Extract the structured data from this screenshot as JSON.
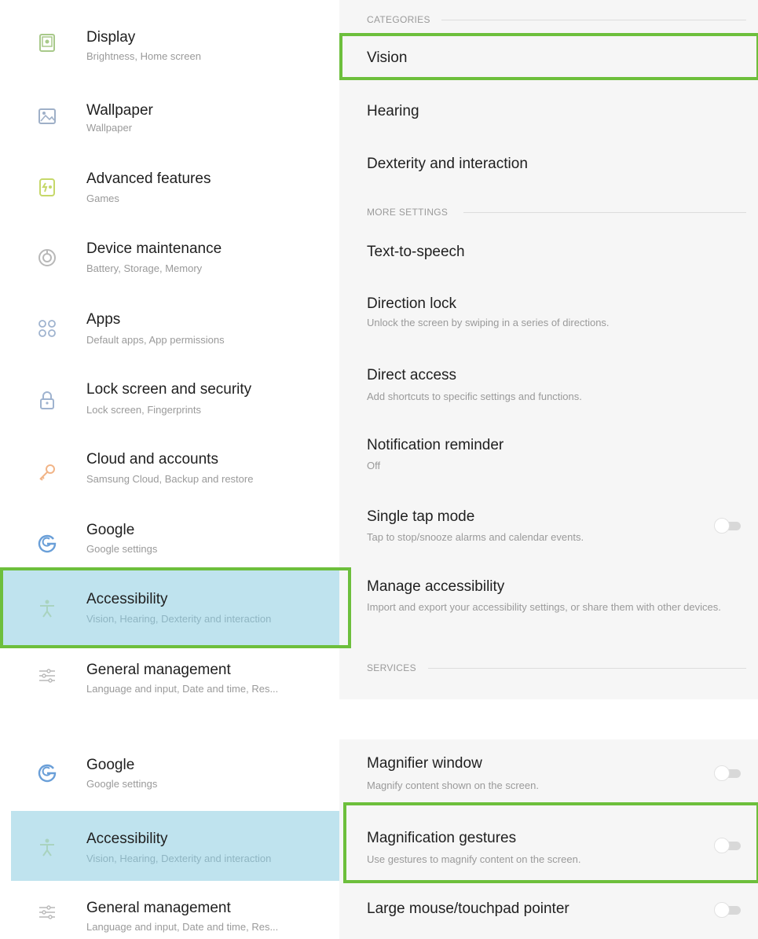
{
  "top_panel": {
    "left_items": [
      {
        "title": "Display",
        "subtitle": "Brightness, Home screen",
        "icon": "display-icon"
      },
      {
        "title": "Wallpaper",
        "subtitle": "Wallpaper",
        "icon": "wallpaper-icon"
      },
      {
        "title": "Advanced features",
        "subtitle": "Games",
        "icon": "advanced-features-icon"
      },
      {
        "title": "Device maintenance",
        "subtitle": "Battery, Storage, Memory",
        "icon": "device-maintenance-icon"
      },
      {
        "title": "Apps",
        "subtitle": "Default apps, App permissions",
        "icon": "apps-grid-icon"
      },
      {
        "title": "Lock screen and security",
        "subtitle": "Lock screen, Fingerprints",
        "icon": "lock-icon"
      },
      {
        "title": "Cloud and accounts",
        "subtitle": "Samsung Cloud, Backup and restore",
        "icon": "key-icon"
      },
      {
        "title": "Google",
        "subtitle": "Google settings",
        "icon": "google-g-icon"
      },
      {
        "title": "Accessibility",
        "subtitle": "Vision, Hearing, Dexterity and interaction",
        "icon": "accessibility-icon",
        "selected": true
      },
      {
        "title": "General management",
        "subtitle": "Language and input, Date and time, Res...",
        "icon": "sliders-icon"
      }
    ],
    "sections": {
      "categories": "CATEGORIES",
      "more_settings": "MORE SETTINGS",
      "services": "SERVICES"
    },
    "categories": [
      "Vision",
      "Hearing",
      "Dexterity and interaction"
    ],
    "more_settings": [
      {
        "title": "Text-to-speech"
      },
      {
        "title": "Direction lock",
        "subtitle": "Unlock the screen by swiping in a series of directions."
      },
      {
        "title": "Direct access",
        "subtitle": "Add shortcuts to specific settings and functions."
      },
      {
        "title": "Notification reminder",
        "subtitle": "Off"
      },
      {
        "title": "Single tap mode",
        "subtitle": "Tap to stop/snooze alarms and calendar events.",
        "toggle": false
      },
      {
        "title": "Manage accessibility",
        "subtitle": "Import and export your accessibility settings, or share them with other devices."
      }
    ]
  },
  "bottom_panel": {
    "left_items": [
      {
        "title": "Google",
        "subtitle": "Google settings",
        "icon": "google-g-icon"
      },
      {
        "title": "Accessibility",
        "subtitle": "Vision, Hearing, Dexterity and interaction",
        "icon": "accessibility-icon",
        "selected": true
      },
      {
        "title": "General management",
        "subtitle": "Language and input, Date and time, Res...",
        "icon": "sliders-icon"
      }
    ],
    "right_items": [
      {
        "title": "Magnifier window",
        "subtitle": "Magnify content shown on the screen.",
        "toggle": false
      },
      {
        "title": "Magnification gestures",
        "subtitle": "Use gestures to magnify content on the screen.",
        "toggle": false
      },
      {
        "title": "Large mouse/touchpad pointer",
        "toggle": false
      }
    ]
  },
  "colors": {
    "highlight": "#6dbf3c",
    "selected_bg": "#bfe3ee",
    "right_panel_bg": "#f6f6f6"
  }
}
